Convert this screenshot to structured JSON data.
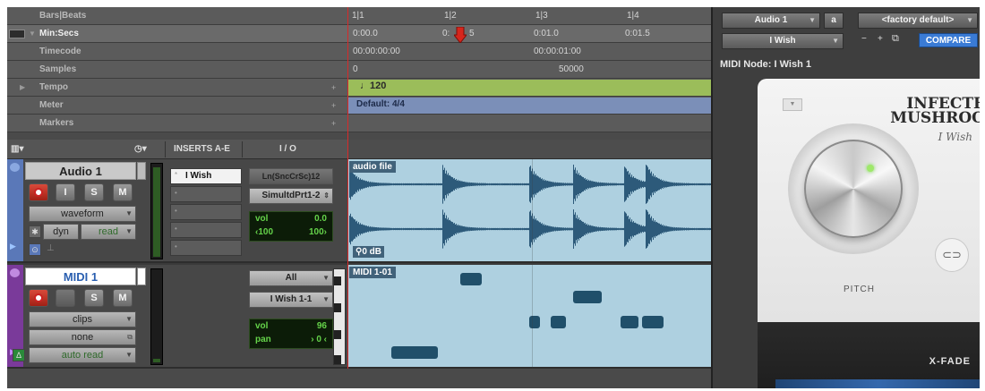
{
  "rulers": {
    "rows": [
      {
        "label": "Bars|Beats"
      },
      {
        "label": "Min:Secs"
      },
      {
        "label": "Timecode"
      },
      {
        "label": "Samples"
      },
      {
        "label": "Tempo"
      },
      {
        "label": "Meter"
      },
      {
        "label": "Markers"
      }
    ],
    "bars_ticks": [
      "1|1",
      "1|2",
      "1|3",
      "1|4"
    ],
    "minsecs_ticks": [
      "0:00.0",
      "0:",
      "5",
      "0:01.0",
      "0:01.5"
    ],
    "timecode_ticks": [
      "00:00:00:00",
      "00:00:01:00"
    ],
    "samples_ticks": [
      "0",
      "50000"
    ],
    "tempo_value": "120",
    "meter_value": "Default: 4/4"
  },
  "header": {
    "inserts_label": "INSERTS A-E",
    "io_label": "I / O"
  },
  "tracks": [
    {
      "name": "Audio 1",
      "color": "#5a78b8",
      "rec": "",
      "input": "I",
      "solo": "S",
      "mute": "M",
      "view": "waveform",
      "dyn": "dyn",
      "automation": "read",
      "insert": "I Wish",
      "io_in": "Ln(SncCrSc)12",
      "io_out": "SimultdPrt1-2",
      "vol_label": "vol",
      "vol_value": "0.0",
      "pan_left": "‹100",
      "pan_right": "100›",
      "clip_name": "audio file",
      "clip_gain": "0 dB"
    },
    {
      "name": "MIDI 1",
      "color": "#7a3a9a",
      "rec": "",
      "solo": "S",
      "mute": "M",
      "view": "clips",
      "subview": "none",
      "automation": "auto read",
      "io_in": "All",
      "io_out": "I Wish 1-1",
      "vol_label": "vol",
      "vol_value": "96",
      "pan_label": "pan",
      "pan_value": "› 0 ‹",
      "clip_name": "MIDI 1-01",
      "notes": [
        {
          "start": 0.31,
          "end": 0.37,
          "pitch": 0.1
        },
        {
          "start": 0.62,
          "end": 0.7,
          "pitch": 0.3
        },
        {
          "start": 0.5,
          "end": 0.53,
          "pitch": 0.58
        },
        {
          "start": 0.56,
          "end": 0.6,
          "pitch": 0.58
        },
        {
          "start": 0.75,
          "end": 0.8,
          "pitch": 0.58
        },
        {
          "start": 0.81,
          "end": 0.87,
          "pitch": 0.58
        },
        {
          "start": 0.12,
          "end": 0.25,
          "pitch": 0.92
        }
      ]
    }
  ],
  "plugin": {
    "track_select": "Audio 1",
    "track_letter": "a",
    "preset": "<factory default>",
    "insert_name": "I Wish",
    "compare_label": "COMPARE",
    "node_label": "MIDI Node: I Wish 1",
    "brand_line1": "INFECTE",
    "brand_line2": "MUSHROO",
    "product_name": "I Wish",
    "pitch_label": "PITCH",
    "xfade_label": "X-FADE",
    "link_icon": "⊂⊃"
  }
}
